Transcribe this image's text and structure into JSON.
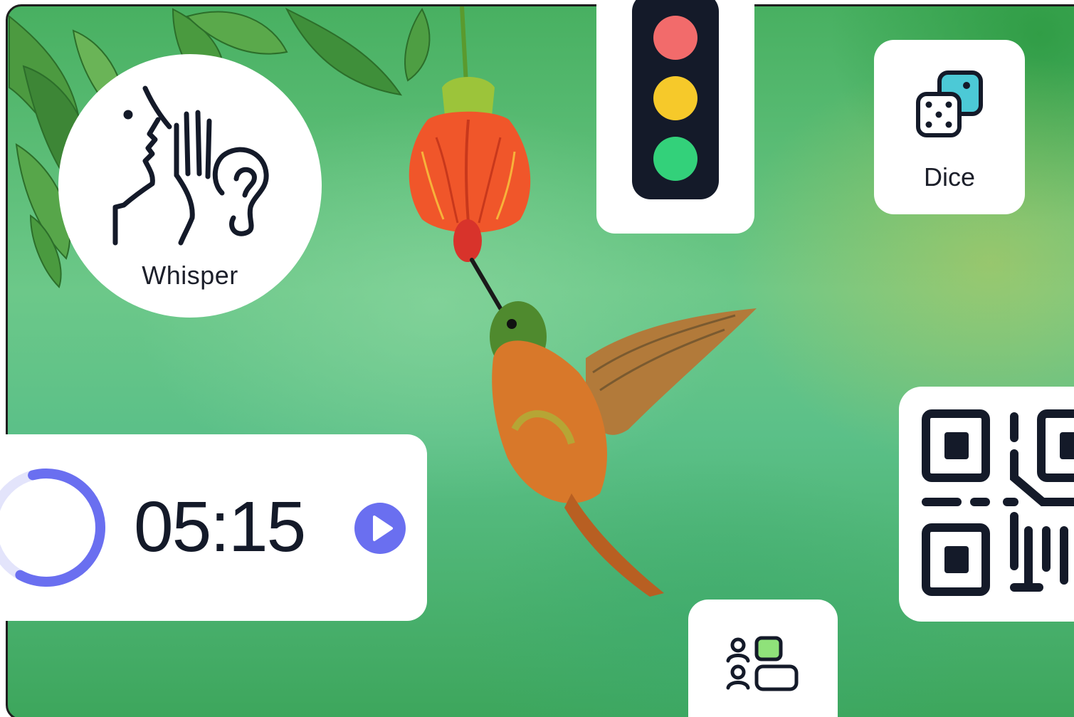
{
  "whisper": {
    "label": "Whisper",
    "icon": "whisper-icon"
  },
  "traffic_light": {
    "colors": [
      "#f26b6b",
      "#f6c92a",
      "#33d17a"
    ],
    "icon": "traffic-light-icon"
  },
  "dice": {
    "label": "Dice",
    "icon": "dice-icon",
    "accent": "#4cc9d6"
  },
  "timer": {
    "value": "05:15",
    "progress": 0.62,
    "accent": "#6a6ff0",
    "icon": "play-icon"
  },
  "qr": {
    "icon": "qr-code-icon"
  },
  "groups": {
    "icon": "group-maker-icon",
    "accent": "#8fe27a"
  },
  "background": {
    "subject": "hummingbird-photo"
  }
}
